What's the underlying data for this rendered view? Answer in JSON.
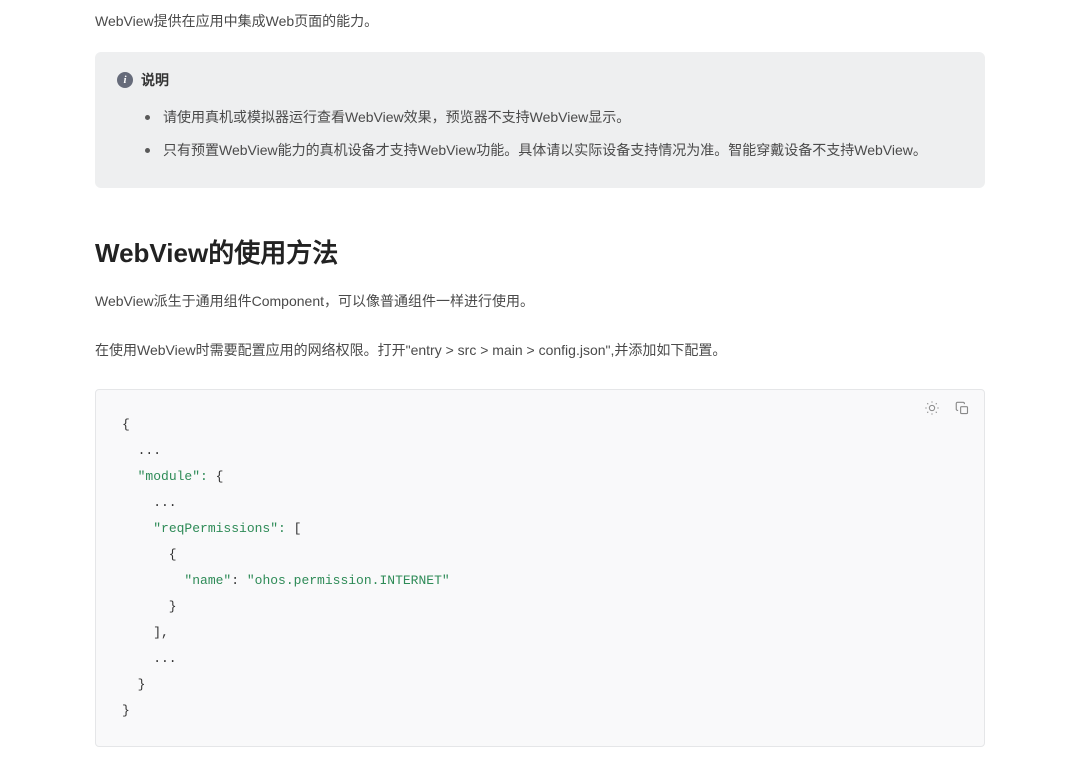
{
  "intro": "WebView提供在应用中集成Web页面的能力。",
  "note": {
    "title": "说明",
    "items": [
      "请使用真机或模拟器运行查看WebView效果，预览器不支持WebView显示。",
      "只有预置WebView能力的真机设备才支持WebView功能。具体请以实际设备支持情况为准。智能穿戴设备不支持WebView。"
    ]
  },
  "section_heading": "WebView的使用方法",
  "paragraphs": [
    "WebView派生于通用组件Component，可以像普通组件一样进行使用。",
    "在使用WebView时需要配置应用的网络权限。打开\"entry > src > main > config.json\",并添加如下配置。"
  ],
  "code": {
    "lines": [
      {
        "t": "{",
        "indent": 0
      },
      {
        "t": "...",
        "indent": 1
      },
      {
        "t": "\"module\": {",
        "indent": 1,
        "keyEnd": 10
      },
      {
        "t": "...",
        "indent": 2
      },
      {
        "t": "\"reqPermissions\": [",
        "indent": 2,
        "keyEnd": 18
      },
      {
        "t": "{",
        "indent": 3
      },
      {
        "kv": true,
        "indent": 4,
        "k": "\"name\"",
        "v": "\"ohos.permission.INTERNET\""
      },
      {
        "t": "}",
        "indent": 3
      },
      {
        "t": "],",
        "indent": 2
      },
      {
        "t": "...",
        "indent": 2
      },
      {
        "t": "}",
        "indent": 1
      },
      {
        "t": "}",
        "indent": 0
      }
    ]
  }
}
